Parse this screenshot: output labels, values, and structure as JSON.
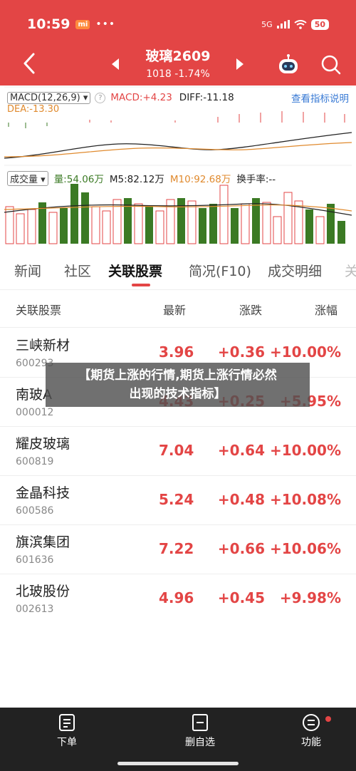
{
  "status_bar": {
    "time": "10:59",
    "mi_badge": "mi",
    "dots": "•••",
    "signal": "5G",
    "battery": "50"
  },
  "header": {
    "title": "玻璃2609",
    "subtitle": "1018 -1.74%"
  },
  "macd": {
    "label": "MACD(12,26,9)",
    "help": "?",
    "macd_value": "MACD:+4.23",
    "diff_value": "DIFF:-11.18",
    "link": "查看指标说明",
    "dea_value": "DEA:-13.30"
  },
  "volume": {
    "label": "成交量",
    "amount": "量:54.06万",
    "m5": "M5:82.12万",
    "m10": "M10:92.68万",
    "turnover": "换手率:--"
  },
  "tabs": [
    "新闻",
    "社区",
    "关联股票",
    "简况(F10)",
    "成交明细",
    "关"
  ],
  "table": {
    "headers": [
      "关联股票",
      "最新",
      "涨跌",
      "涨幅"
    ],
    "rows": [
      {
        "name": "三峡新材",
        "code": "600293",
        "price": "3.96",
        "change": "+0.36",
        "pct": "+10.00%"
      },
      {
        "name": "南玻A",
        "code": "000012",
        "price": "4.43",
        "change": "+0.25",
        "pct": "+5.95%"
      },
      {
        "name": "耀皮玻璃",
        "code": "600819",
        "price": "7.04",
        "change": "+0.64",
        "pct": "+10.00%"
      },
      {
        "name": "金晶科技",
        "code": "600586",
        "price": "5.24",
        "change": "+0.48",
        "pct": "+10.08%"
      },
      {
        "name": "旗滨集团",
        "code": "601636",
        "price": "7.22",
        "change": "+0.66",
        "pct": "+10.06%"
      },
      {
        "name": "北玻股份",
        "code": "002613",
        "price": "4.96",
        "change": "+0.45",
        "pct": "+9.98%"
      }
    ]
  },
  "overlay": {
    "line1": "【期货上涨的行情,期货上涨行情必然",
    "line2": "出现的技术指标】"
  },
  "bottom_nav": [
    {
      "label": "下单",
      "icon": "order-icon"
    },
    {
      "label": "删自选",
      "icon": "remove-watchlist-icon"
    },
    {
      "label": "功能",
      "icon": "menu-icon"
    }
  ],
  "colors": {
    "accent": "#e34545",
    "down": "#3b7a24",
    "ma": "#e08a2e"
  }
}
